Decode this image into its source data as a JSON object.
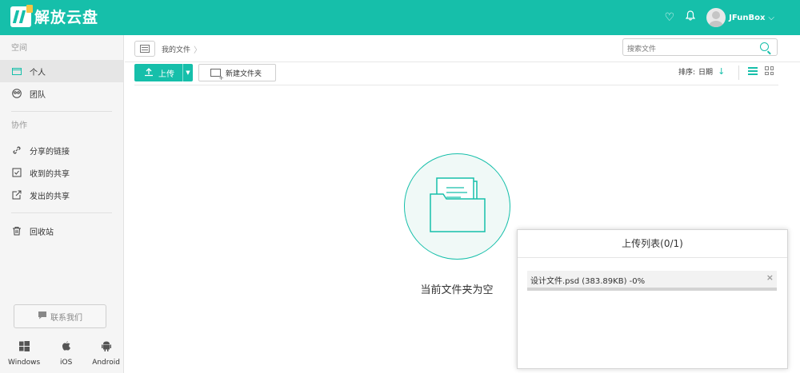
{
  "app": {
    "title": "解放云盘"
  },
  "header": {
    "user_name": "JFunBox",
    "favorite_icon": "heart-icon",
    "bell_icon": "bell-icon"
  },
  "sidebar": {
    "section_space": "空间",
    "personal": "个人",
    "team": "团队",
    "section_collab": "协作",
    "shared_links": "分享的链接",
    "received_shares": "收到的共享",
    "sent_shares": "发出的共享",
    "recycle": "回收站",
    "contact": "联系我们",
    "platforms": [
      "Windows",
      "iOS",
      "Android"
    ]
  },
  "breadcrumb": {
    "current": "我的文件"
  },
  "search": {
    "placeholder": "搜索文件"
  },
  "toolbar": {
    "upload": "上传",
    "new_folder": "新建文件夹",
    "sort_label": "排序:",
    "sort_value": "日期"
  },
  "empty_state": {
    "text": "当前文件夹为空"
  },
  "upload_panel": {
    "title": "上传列表(0/1)",
    "file_entry": "设计文件.psd (383.89KB) -0%",
    "progress": 0
  },
  "colors": {
    "accent": "#16bfaa"
  }
}
